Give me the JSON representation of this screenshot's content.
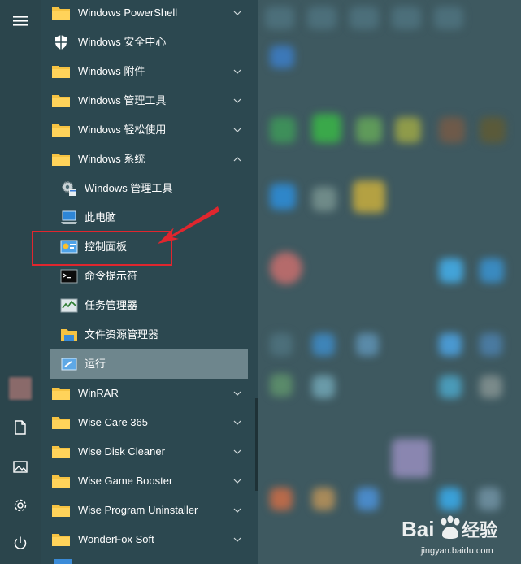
{
  "app_list": {
    "items": [
      {
        "label": "Windows PowerShell",
        "icon": "folder-icon",
        "chevron": "down"
      },
      {
        "label": "Windows 安全中心",
        "icon": "shield-icon",
        "chevron": ""
      },
      {
        "label": "Windows 附件",
        "icon": "folder-icon",
        "chevron": "down"
      },
      {
        "label": "Windows 管理工具",
        "icon": "folder-icon",
        "chevron": "down"
      },
      {
        "label": "Windows 轻松使用",
        "icon": "folder-icon",
        "chevron": "down"
      },
      {
        "label": "Windows 系统",
        "icon": "folder-icon",
        "chevron": "up"
      },
      {
        "label": "Windows 管理工具",
        "icon": "admin-tools-icon",
        "chevron": ""
      },
      {
        "label": "此电脑",
        "icon": "computer-icon",
        "chevron": ""
      },
      {
        "label": "控制面板",
        "icon": "control-panel-icon",
        "chevron": ""
      },
      {
        "label": "命令提示符",
        "icon": "cmd-icon",
        "chevron": ""
      },
      {
        "label": "任务管理器",
        "icon": "task-manager-icon",
        "chevron": ""
      },
      {
        "label": "文件资源管理器",
        "icon": "explorer-icon",
        "chevron": ""
      },
      {
        "label": "运行",
        "icon": "run-icon",
        "chevron": ""
      },
      {
        "label": "WinRAR",
        "icon": "folder-icon",
        "chevron": "down"
      },
      {
        "label": "Wise Care 365",
        "icon": "folder-icon",
        "chevron": "down"
      },
      {
        "label": "Wise Disk Cleaner",
        "icon": "folder-icon",
        "chevron": "down"
      },
      {
        "label": "Wise Game Booster",
        "icon": "folder-icon",
        "chevron": "down"
      },
      {
        "label": "Wise Program Uninstaller",
        "icon": "folder-icon",
        "chevron": "down"
      },
      {
        "label": "WonderFox Soft",
        "icon": "folder-icon",
        "chevron": "down"
      }
    ]
  },
  "rail": {
    "icons": [
      "hamburger-menu-icon",
      "user-avatar",
      "document-icon",
      "pictures-icon",
      "settings-icon",
      "power-icon"
    ]
  },
  "annotation": {
    "box_color": "#e0262e",
    "target": "控制面板"
  },
  "watermark": {
    "brand": "Bai",
    "brand_suffix": "经验",
    "url": "jingyan.baidu.com"
  },
  "colors": {
    "list_bg": "#2c4850",
    "highlight_bg": "#6e868d",
    "folder_yellow": "#f6c342"
  }
}
